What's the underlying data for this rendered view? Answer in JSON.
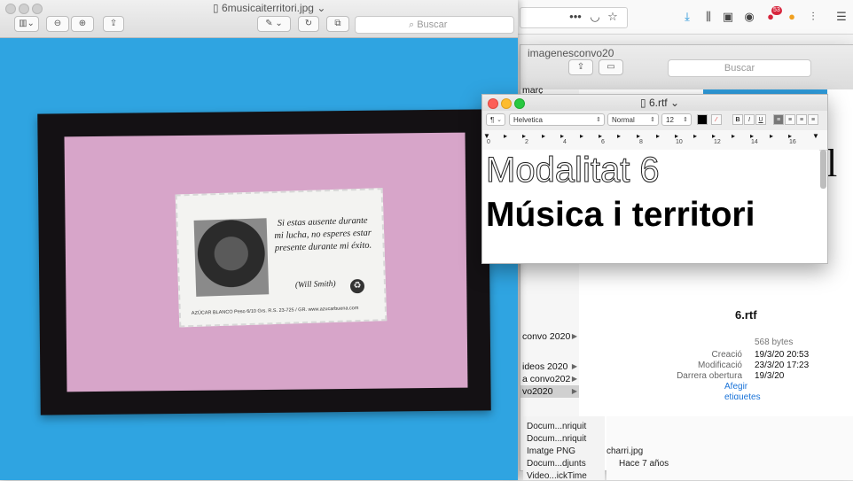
{
  "firefox": {
    "badge": "53"
  },
  "finder_back": {
    "title": "imagenesconvo20",
    "search_placeholder": "Buscar",
    "col1_items": [
      "març",
      "convo 2020",
      "ideos 2020",
      "a convo202",
      "vo2020"
    ],
    "file": {
      "name": "6.rtf",
      "size": "568 bytes",
      "created_label": "Creació",
      "created": "19/3/20 20:53",
      "modified_label": "Modificació",
      "modified": "23/3/20 17:23",
      "opened_label": "Darrera obertura",
      "opened": "19/3/20",
      "tags_link": "Afegir etiquetes"
    }
  },
  "finder_kinds": [
    "Docum...nriquit",
    "Docum...nriquit",
    "Imatge PNG",
    "Docum...djunts",
    "Video...ickTime"
  ],
  "bottom_strip": {
    "file": "charri.jpg",
    "when": "Hace 7 años"
  },
  "preview": {
    "title": "6musicaiterritori.jpg",
    "search_placeholder": "Buscar",
    "sachet": {
      "quote": "Si estas ausente durante mi lucha, no esperes estar presente durante mi éxito.",
      "author": "(Will Smith)",
      "footer": "AZÚCAR BLANCO  Peso 6/10 Grs. R.S. 23-725 / GR. www.azucarbuena.com"
    }
  },
  "textedit": {
    "title": "6.rtf",
    "paragraph_style": "¶",
    "font_family": "Helvetica",
    "font_style": "Normal",
    "font_size": "12",
    "bold": "B",
    "italic": "I",
    "underline": "U",
    "ruler_numbers": [
      "0",
      "2",
      "4",
      "6",
      "8",
      "10",
      "12",
      "14",
      "16"
    ],
    "line1": "Modalitat 6",
    "line2": "Música i territori"
  }
}
